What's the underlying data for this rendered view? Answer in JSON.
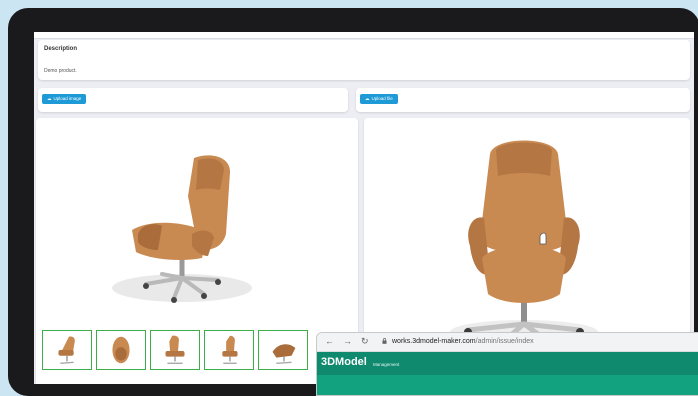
{
  "description": {
    "title": "Description",
    "text": "Demo product."
  },
  "upload": {
    "image_label": "Upload image",
    "file_label": "Upload file",
    "icon": "cloud-upload-icon"
  },
  "thumbnails": [
    "chair-side-view",
    "chair-top-view",
    "chair-front-angle",
    "chair-side-angle",
    "chair-reclined"
  ],
  "browser": {
    "url_host": "works.3dmodel-maker.com",
    "url_path": "/admin/issue/index",
    "back_icon": "arrow-left-icon",
    "forward_icon": "arrow-right-icon",
    "reload_icon": "reload-icon",
    "lock_icon": "lock-icon"
  },
  "app": {
    "title": "3DModel",
    "subtitle": "Management"
  },
  "colors": {
    "upload_button": "#1e9ad6",
    "thumbnail_border": "#3cae48",
    "app_header": "#0f8a6e",
    "chair_leather": "#c98a52"
  }
}
